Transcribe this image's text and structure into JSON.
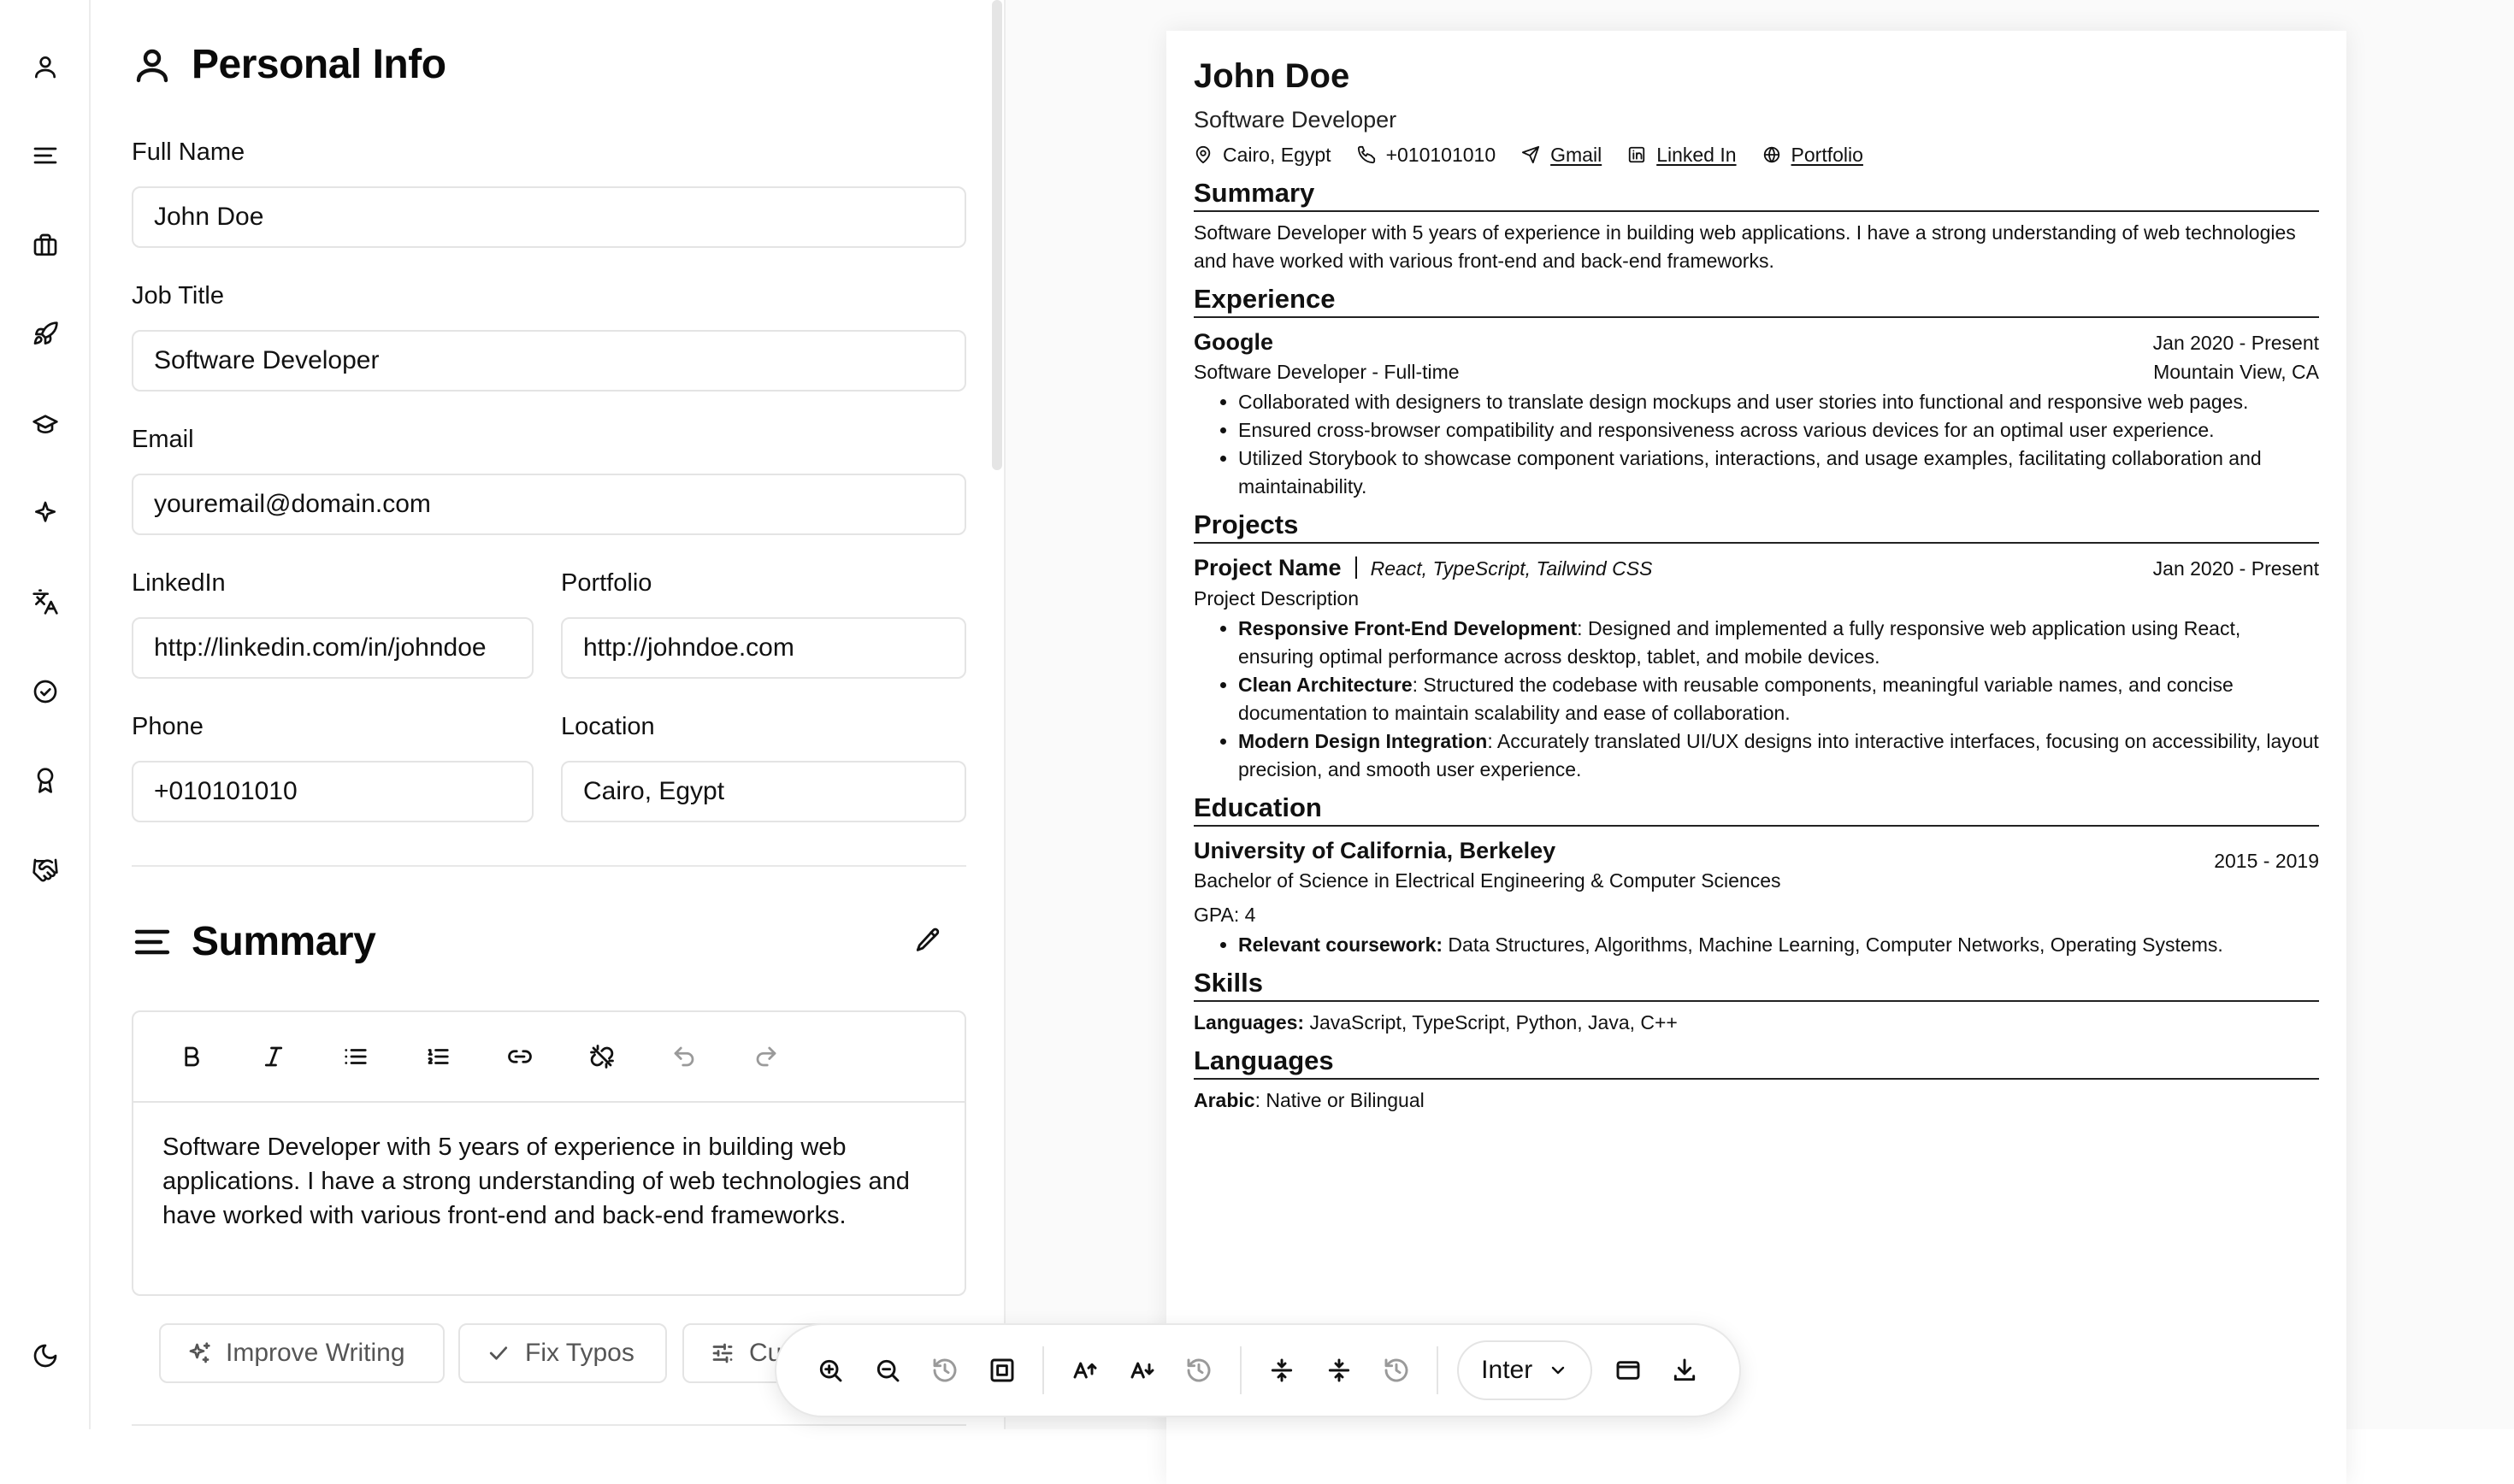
{
  "rail": {
    "items": [
      "user-icon",
      "align-left-icon",
      "briefcase-icon",
      "rocket-icon",
      "graduation-cap-icon",
      "sparkle-icon",
      "languages-icon",
      "check-circle-icon",
      "award-icon",
      "handshake-icon",
      "moon-icon"
    ]
  },
  "personal": {
    "title": "Personal Info",
    "full_name_label": "Full Name",
    "full_name": "John Doe",
    "job_title_label": "Job Title",
    "job_title": "Software Developer",
    "email_label": "Email",
    "email": "youremail@domain.com",
    "linkedin_label": "LinkedIn",
    "linkedin": "http://linkedin.com/in/johndoe",
    "portfolio_label": "Portfolio",
    "portfolio": "http://johndoe.com",
    "phone_label": "Phone",
    "phone": "+010101010",
    "location_label": "Location",
    "location": "Cairo, Egypt"
  },
  "summary": {
    "title": "Summary",
    "text": "Software Developer with 5 years of experience in building web applications. I have a strong understanding of web technologies and have worked with various front-end and back-end frameworks.",
    "actions": [
      "Improve Writing",
      "Fix Typos",
      "Cu"
    ]
  },
  "toolbar": {
    "font": "Inter"
  },
  "cv": {
    "name": "John Doe",
    "job": "Software Developer",
    "location": "Cairo, Egypt",
    "phone": "+010101010",
    "gmail": "Gmail",
    "linkedin": "Linked In",
    "portfolio": "Portfolio",
    "summary_h": "Summary",
    "summary": "Software Developer with 5 years of experience in building web applications. I have a strong understanding of web technologies and have worked with various front-end and back-end frameworks.",
    "experience_h": "Experience",
    "exp_company": "Google",
    "exp_dates": "Jan 2020 - Present",
    "exp_role": "Software Developer - Full-time",
    "exp_location": "Mountain View, CA",
    "exp_bullets": [
      "Collaborated with designers to translate design mockups and user stories into functional and responsive web pages.",
      "Ensured cross-browser compatibility and responsiveness across various devices for an optimal user experience.",
      "Utilized Storybook to showcase component variations, interactions, and usage examples, facilitating collaboration and maintainability."
    ],
    "projects_h": "Projects",
    "proj_name": "Project Name",
    "proj_tech": "React, TypeScript, Tailwind CSS",
    "proj_dates": "Jan 2020 - Present",
    "proj_desc": "Project Description",
    "proj_b1_strong": "Responsive Front-End Development",
    "proj_b1": ": Designed and implemented a fully responsive web application using React, ensuring optimal performance across desktop, tablet, and mobile devices.",
    "proj_b2_strong": "Clean Architecture",
    "proj_b2": ": Structured the codebase with reusable components, meaningful variable names, and concise documentation to maintain scalability and ease of collaboration.",
    "proj_b3_strong": "Modern Design Integration",
    "proj_b3": ": Accurately translated UI/UX designs into interactive interfaces, focusing on accessibility, layout precision, and smooth user experience.",
    "education_h": "Education",
    "edu_school": "University of California, Berkeley",
    "edu_dates": "2015 - 2019",
    "edu_degree": "Bachelor of Science in Electrical Engineering & Computer Sciences",
    "edu_gpa": "GPA: 4",
    "edu_b_strong": "Relevant coursework:",
    "edu_b": " Data Structures, Algorithms, Machine Learning, Computer Networks, Operating Systems.",
    "skills_h": "Skills",
    "skills_strong": "Languages:",
    "skills": " JavaScript, TypeScript, Python, Java, C++",
    "languages_h": "Languages",
    "lang_strong": "Arabic",
    "lang": ": Native or Bilingual"
  }
}
